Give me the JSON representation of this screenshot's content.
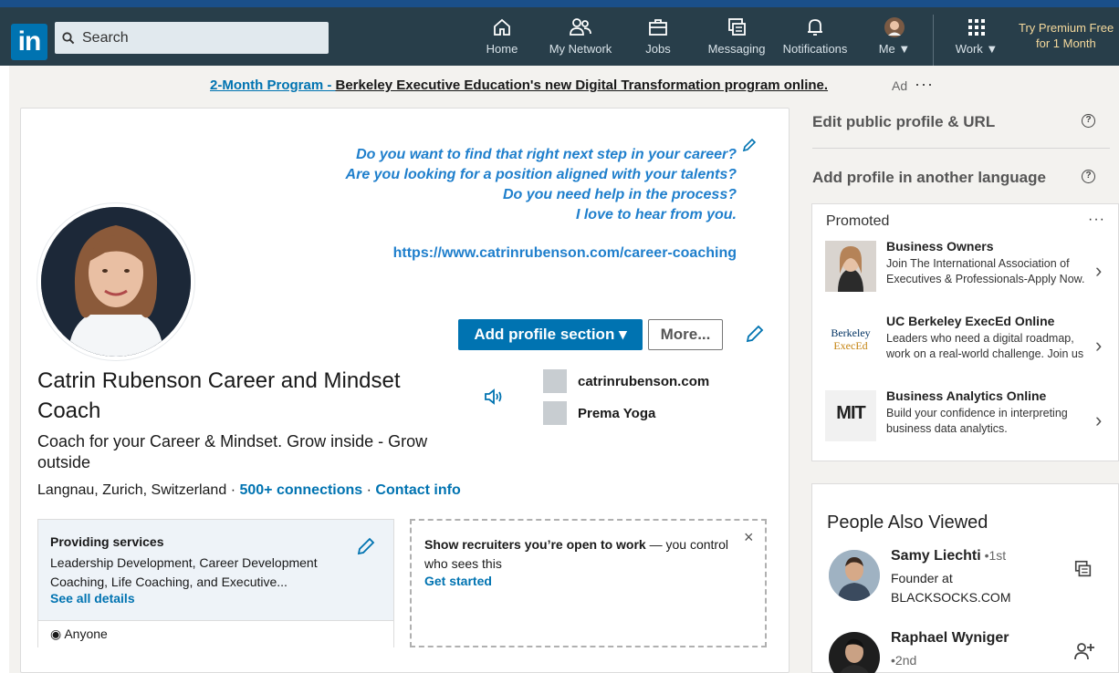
{
  "nav": {
    "logo": "in",
    "search_placeholder": "Search",
    "items": [
      {
        "label": "Home",
        "icon": "home-icon"
      },
      {
        "label": "My Network",
        "icon": "network-icon"
      },
      {
        "label": "Jobs",
        "icon": "briefcase-icon"
      },
      {
        "label": "Messaging",
        "icon": "messaging-icon"
      },
      {
        "label": "Notifications",
        "icon": "bell-icon"
      },
      {
        "label": "Me",
        "icon": "avatar-icon"
      },
      {
        "label": "Work",
        "icon": "grid-icon"
      }
    ],
    "premium_line1": "Try Premium Free",
    "premium_line2": "for 1 Month"
  },
  "ad": {
    "link": "2-Month Program - ",
    "text": "Berkeley Executive Education's new Digital Transformation program online.",
    "label": "Ad",
    "dots": "···"
  },
  "profile": {
    "cover_lines": [
      "Do you want to find that right next step in your career?",
      "Are you looking for a position aligned with your talents?",
      "Do you need help in the process?",
      "I love to hear from you."
    ],
    "cover_url": "https://www.catrinrubenson.com/career-coaching",
    "add_section_label": "Add profile section",
    "more_label": "More...",
    "name": "Catrin Rubenson Career and Mindset Coach",
    "headline": "Coach for your Career & Mindset. Grow inside - Grow outside",
    "location": "Langnau, Zurich, Switzerland",
    "connections": "500+ connections",
    "contact": "Contact info",
    "companies": [
      "catrinrubenson.com",
      "Prema Yoga"
    ]
  },
  "services": {
    "title": "Providing services",
    "desc": "Leadership Development, Career Development Coaching, Life Coaching, and Executive...",
    "see_all": "See all details",
    "visibility": "Anyone"
  },
  "open_to_work": {
    "bold": "Show recruiters you’re open to work",
    "rest": " — you control who sees this",
    "cta": "Get started",
    "close": "×"
  },
  "sidebar": {
    "edit_url": "Edit public profile & URL",
    "add_language": "Add profile in another language",
    "promoted_title": "Promoted",
    "promoted_dots": "···",
    "promoted": [
      {
        "title": "Business Owners",
        "desc": "Join The International Association of Executives & Professionals-Apply Now."
      },
      {
        "title": "UC Berkeley ExecEd Online",
        "desc": "Leaders who need a digital roadmap, work on a real-world challenge. Join us",
        "logo_line1": "Berkeley",
        "logo_line2": "ExecEd"
      },
      {
        "title": "Business Analytics Online",
        "desc": "Build your confidence in interpreting business data analytics.",
        "logo": "MIT"
      }
    ],
    "people_title": "People Also Viewed",
    "people": [
      {
        "name": "Samy Liechti",
        "degree": " •1st",
        "desc": "Founder at BLACKSOCKS.COM"
      },
      {
        "name": "Raphael Wyniger",
        "degree": "",
        "desc": "•2nd"
      }
    ]
  }
}
